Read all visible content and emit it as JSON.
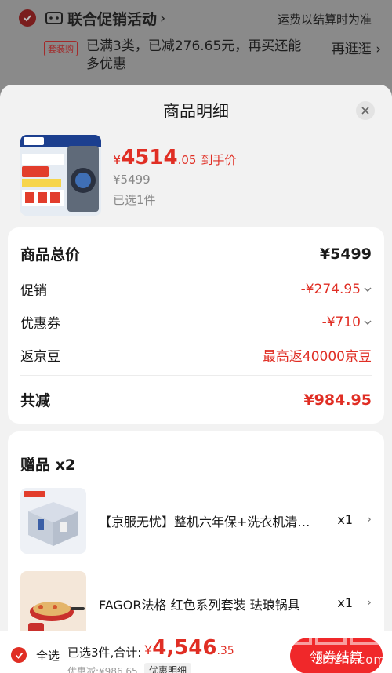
{
  "background": {
    "promo_title": "联合促销活动",
    "promo_chevron": "›",
    "shipping_note": "运费以结算时为准",
    "tag": "套装购",
    "tag_text": "已满3类，已减276.65元，再买还能多优惠",
    "tag_link": "再逛逛 ›"
  },
  "sheet": {
    "title": "商品明细",
    "close_icon": "close-icon"
  },
  "product": {
    "price_symbol": "¥",
    "price_int": "4514",
    "price_dec": ".05",
    "price_suffix": "到手价",
    "original_price": "¥5499",
    "selected": "已选1件"
  },
  "summary": {
    "total_label": "商品总价",
    "total_value": "¥5499",
    "promo_label": "促销",
    "promo_value": "-¥274.95",
    "coupon_label": "优惠券",
    "coupon_value": "-¥710",
    "bean_label": "返京豆",
    "bean_value": "最高返40000京豆",
    "reduce_label": "共减",
    "reduce_value": "¥984.95"
  },
  "gifts": {
    "title": "赠品 x2",
    "items": [
      {
        "name": "【京服无忧】整机六年保+洗衣机清洗服务",
        "qty": "x1"
      },
      {
        "name": "FAGOR法格 红色系列套装 珐琅锅具",
        "qty": "x1"
      }
    ]
  },
  "bottom": {
    "select_all": "全选",
    "summary": "已选3件,合计:",
    "total_symbol": "¥",
    "total_int": "4,546",
    "total_dec": ".35",
    "discount": "优惠减:¥986.65",
    "detail_label": "优惠明细",
    "checkout": "领券结算"
  },
  "watermark": {
    "text": "zhizhi.com"
  },
  "colors": {
    "accent_red": "#e02e24",
    "checkout_red": "#f0282a"
  }
}
